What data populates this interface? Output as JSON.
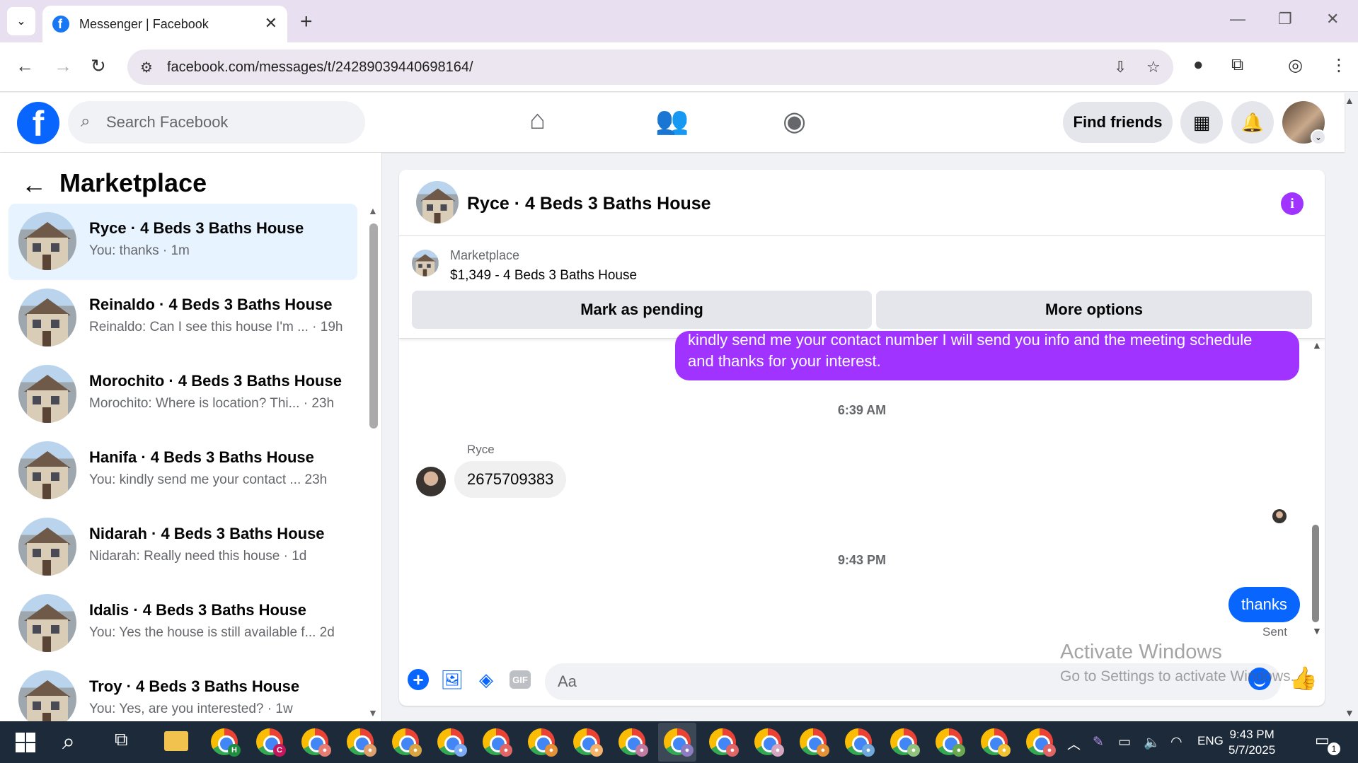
{
  "browser": {
    "tab_title": "Messenger | Facebook",
    "url": "facebook.com/messages/t/24289039440698164/"
  },
  "fb": {
    "search_placeholder": "Search Facebook",
    "find_friends": "Find friends"
  },
  "sidebar": {
    "title": "Marketplace",
    "conversations": [
      {
        "name": "Ryce · 4 Beds 3 Baths House",
        "snippet": "You: thanks · 1m",
        "active": true
      },
      {
        "name": "Reinaldo · 4 Beds 3 Baths House",
        "snippet": "Reinaldo: Can I see this house I'm ... · 19h"
      },
      {
        "name": "Morochito · 4 Beds 3 Baths House",
        "snippet": "Morochito: Where is location? Thi... · 23h"
      },
      {
        "name": "Hanifa · 4 Beds 3 Baths House",
        "snippet": "You: kindly send me your contact ...  23h"
      },
      {
        "name": "Nidarah · 4 Beds 3 Baths House",
        "snippet": "Nidarah: Really need this house · 1d"
      },
      {
        "name": "Idalis · 4 Beds 3 Baths House",
        "snippet": "You: Yes the house is still available f...  2d"
      },
      {
        "name": "Troy · 4 Beds 3 Baths House",
        "snippet": "You: Yes, are you interested? · 1w"
      }
    ]
  },
  "chat": {
    "title": "Ryce · 4 Beds 3 Baths House",
    "marketplace_label": "Marketplace",
    "listing": "$1,349 - 4 Beds 3 Baths House",
    "mark_pending": "Mark as pending",
    "more_options": "More options",
    "msg_out_line1": "kindly send me your contact number I will send you info and the meeting schedule",
    "msg_out_line2": "and thanks for your interest.",
    "time1": "6:39 AM",
    "sender": "Ryce",
    "msg_in": "2675709383",
    "time2": "9:43 PM",
    "msg_thanks": "thanks",
    "sent_label": "Sent",
    "input_placeholder": "Aa",
    "gif_label": "GIF"
  },
  "watermark": {
    "line1": "Activate Windows",
    "line2": "Go to Settings to activate Windows."
  },
  "taskbar": {
    "lang": "ENG",
    "time": "9:43 PM",
    "date": "5/7/2025",
    "notif_count": "1"
  }
}
